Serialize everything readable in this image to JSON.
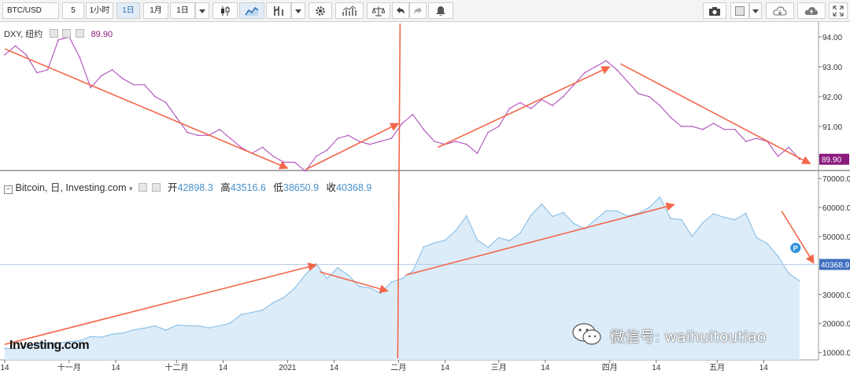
{
  "toolbar": {
    "symbol": "BTC/USD",
    "interval_value": "5",
    "timeframes": [
      "1小时",
      "1日",
      "1月",
      "1日"
    ],
    "active_timeframe": "1日"
  },
  "colors": {
    "dxy_line": "#b45cc0",
    "btc_line": "#8fc3e8",
    "btc_fill": "#dcecf9",
    "arrow": "#f2674a",
    "dxy_price_tag": "#8b1a7e",
    "btc_price_tag": "#3f6fbf"
  },
  "dxy_legend": {
    "label": "DXY, 纽约",
    "value": "89.90"
  },
  "btc_legend": {
    "label": "Bitcoin, 日, Investing.com",
    "open_label": "开",
    "open": "42898.3",
    "high_label": "高",
    "high": "43516.6",
    "low_label": "低",
    "low": "38650.9",
    "close_label": "收",
    "close": "40368.9"
  },
  "watermark": "微信号: waihuitoutiao",
  "logo": "Investing.com",
  "chart_data": [
    {
      "type": "line",
      "title": "DXY, 纽约",
      "yticks": [
        "94.00",
        "93.00",
        "92.00",
        "91.00",
        "90.00"
      ],
      "ylim": [
        89.55,
        94.5
      ],
      "last_value_label": "89.90",
      "x": [
        "2020-10-14",
        "2020-10-17",
        "2020-10-20",
        "2020-10-23",
        "2020-10-26",
        "2020-10-29",
        "2020-11-01",
        "2020-11-04",
        "2020-11-07",
        "2020-11-10",
        "2020-11-13",
        "2020-11-16",
        "2020-11-19",
        "2020-11-22",
        "2020-11-25",
        "2020-11-28",
        "2020-12-01",
        "2020-12-04",
        "2020-12-07",
        "2020-12-10",
        "2020-12-13",
        "2020-12-16",
        "2020-12-19",
        "2020-12-22",
        "2020-12-25",
        "2020-12-28",
        "2020-12-31",
        "2021-01-03",
        "2021-01-06",
        "2021-01-09",
        "2021-01-12",
        "2021-01-15",
        "2021-01-18",
        "2021-01-21",
        "2021-01-24",
        "2021-01-27",
        "2021-01-30",
        "2021-02-02",
        "2021-02-05",
        "2021-02-08",
        "2021-02-11",
        "2021-02-14",
        "2021-02-17",
        "2021-02-20",
        "2021-02-23",
        "2021-02-26",
        "2021-03-01",
        "2021-03-04",
        "2021-03-07",
        "2021-03-10",
        "2021-03-13",
        "2021-03-16",
        "2021-03-19",
        "2021-03-22",
        "2021-03-25",
        "2021-03-28",
        "2021-03-31",
        "2021-04-03",
        "2021-04-06",
        "2021-04-09",
        "2021-04-12",
        "2021-04-15",
        "2021-04-18",
        "2021-04-21",
        "2021-04-24",
        "2021-04-27",
        "2021-04-30",
        "2021-05-03",
        "2021-05-06",
        "2021-05-09",
        "2021-05-12",
        "2021-05-15",
        "2021-05-18",
        "2021-05-21",
        "2021-05-24"
      ],
      "values": [
        93.4,
        93.7,
        93.4,
        92.8,
        92.9,
        93.9,
        94.0,
        93.3,
        92.3,
        92.7,
        92.9,
        92.6,
        92.4,
        92.4,
        92.0,
        91.8,
        91.3,
        90.8,
        90.7,
        90.7,
        90.9,
        90.6,
        90.3,
        90.1,
        90.3,
        90.0,
        89.8,
        89.8,
        89.5,
        90.0,
        90.2,
        90.6,
        90.7,
        90.5,
        90.4,
        90.5,
        90.6,
        91.1,
        91.4,
        90.9,
        90.5,
        90.4,
        90.5,
        90.4,
        90.1,
        90.8,
        91.0,
        91.6,
        91.8,
        91.6,
        91.9,
        91.7,
        92.0,
        92.4,
        92.8,
        93.0,
        93.2,
        92.9,
        92.5,
        92.1,
        92.0,
        91.7,
        91.3,
        91.0,
        91.0,
        90.9,
        91.1,
        90.9,
        90.9,
        90.5,
        90.6,
        90.5,
        90.0,
        90.3,
        89.9
      ],
      "trend_arrows": [
        {
          "from": [
            "2020-10-14",
            93.6
          ],
          "to": [
            "2021-01-01",
            89.6
          ]
        },
        {
          "from": [
            "2021-01-06",
            89.55
          ],
          "to": [
            "2021-02-01",
            91.1
          ]
        },
        {
          "from": [
            "2021-02-12",
            90.3
          ],
          "to": [
            "2021-04-01",
            93.0
          ]
        },
        {
          "from": [
            "2021-04-04",
            93.1
          ],
          "to": [
            "2021-05-27",
            89.75
          ]
        }
      ]
    },
    {
      "type": "area",
      "title": "Bitcoin, 日, Investing.com",
      "yticks": [
        "70000.0",
        "60000.0",
        "50000.0",
        "30000.0",
        "20000.0",
        "10000.0"
      ],
      "ylim": [
        8000,
        72500
      ],
      "last_value_label": "40368.9",
      "reference_line": 40368.9,
      "x_tick_labels": [
        "14",
        "十一月",
        "14",
        "十二月",
        "14",
        "2021",
        "14",
        "二月",
        "14",
        "三月",
        "14",
        "四月",
        "14",
        "五月",
        "14"
      ],
      "x_tick_dates": [
        "2020-10-14",
        "2020-11-01",
        "2020-11-14",
        "2020-12-01",
        "2020-12-14",
        "2021-01-01",
        "2021-01-14",
        "2021-02-01",
        "2021-02-14",
        "2021-03-01",
        "2021-03-14",
        "2021-04-01",
        "2021-04-14",
        "2021-05-01",
        "2021-05-14"
      ],
      "x": [
        "2020-10-14",
        "2020-10-17",
        "2020-10-20",
        "2020-10-23",
        "2020-10-26",
        "2020-10-29",
        "2020-11-01",
        "2020-11-04",
        "2020-11-07",
        "2020-11-10",
        "2020-11-13",
        "2020-11-16",
        "2020-11-19",
        "2020-11-22",
        "2020-11-25",
        "2020-11-28",
        "2020-12-01",
        "2020-12-04",
        "2020-12-07",
        "2020-12-10",
        "2020-12-13",
        "2020-12-16",
        "2020-12-19",
        "2020-12-22",
        "2020-12-25",
        "2020-12-28",
        "2020-12-31",
        "2021-01-03",
        "2021-01-06",
        "2021-01-09",
        "2021-01-12",
        "2021-01-15",
        "2021-01-18",
        "2021-01-21",
        "2021-01-24",
        "2021-01-27",
        "2021-01-30",
        "2021-02-02",
        "2021-02-05",
        "2021-02-08",
        "2021-02-11",
        "2021-02-14",
        "2021-02-17",
        "2021-02-20",
        "2021-02-23",
        "2021-02-26",
        "2021-03-01",
        "2021-03-04",
        "2021-03-07",
        "2021-03-10",
        "2021-03-13",
        "2021-03-16",
        "2021-03-19",
        "2021-03-22",
        "2021-03-25",
        "2021-03-28",
        "2021-03-31",
        "2021-04-03",
        "2021-04-06",
        "2021-04-09",
        "2021-04-12",
        "2021-04-15",
        "2021-04-18",
        "2021-04-21",
        "2021-04-24",
        "2021-04-27",
        "2021-04-30",
        "2021-05-03",
        "2021-05-06",
        "2021-05-09",
        "2021-05-12",
        "2021-05-15",
        "2021-05-18",
        "2021-05-21",
        "2021-05-24"
      ],
      "values": [
        11400,
        11300,
        11900,
        12900,
        13100,
        13300,
        13700,
        14100,
        15500,
        15300,
        16300,
        16700,
        17800,
        18400,
        19200,
        17700,
        19400,
        19200,
        19200,
        18500,
        19200,
        20200,
        23100,
        23800,
        24600,
        27200,
        29000,
        32200,
        36800,
        40600,
        35500,
        39200,
        36700,
        32800,
        32300,
        30400,
        34300,
        35500,
        38100,
        46400,
        47800,
        48700,
        52000,
        57100,
        48800,
        46300,
        49600,
        48600,
        51200,
        57400,
        61200,
        56900,
        58300,
        54500,
        52600,
        55800,
        58900,
        58800,
        57100,
        58000,
        60000,
        63600,
        56200,
        55800,
        50100,
        54800,
        57800,
        56600,
        55800,
        58000,
        49600,
        47600,
        43200,
        37300,
        34700
      ],
      "trend_arrows": [
        {
          "from": [
            "2020-10-14",
            12800
          ],
          "to": [
            "2021-01-09",
            40200
          ]
        },
        {
          "from": [
            "2021-01-10",
            37800
          ],
          "to": [
            "2021-01-29",
            31200
          ]
        },
        {
          "from": [
            "2021-02-03",
            36700
          ],
          "to": [
            "2021-04-19",
            61000
          ]
        },
        {
          "from": [
            "2021-05-19",
            58800
          ],
          "to": [
            "2021-05-28",
            40800
          ]
        }
      ],
      "event_marker": {
        "date": "2021-02-01",
        "label": "P"
      }
    }
  ]
}
